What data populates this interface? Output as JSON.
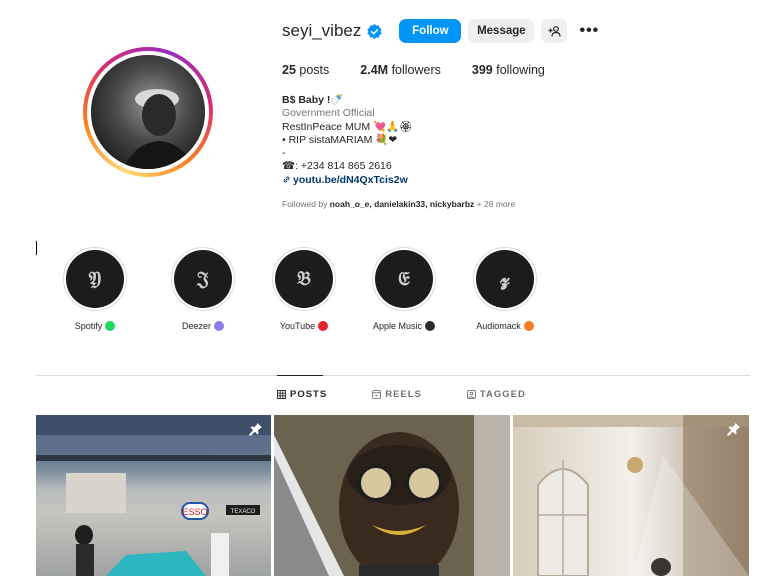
{
  "profile": {
    "username": "seyi_vibez",
    "follow_label": "Follow",
    "message_label": "Message",
    "more_label": "•••",
    "stats": {
      "posts_count": "25",
      "posts_label": "posts",
      "followers_count": "2.4M",
      "followers_label": "followers",
      "following_count": "399",
      "following_label": "following"
    },
    "bio": {
      "name": "B$ Baby !🍼",
      "category": "Government Official",
      "line1": "RestInPeace MUM 💘🙏🏵",
      "line2": "• RIP sistaMARIAM 💐❤",
      "line3": "-",
      "phone": "☎: +234 814 865 2616",
      "link": "youtu.be/dN4QxTcis2w"
    },
    "followed_by": {
      "prefix": "Followed by",
      "names": "noah_o_e, danielakin33, nickybarbz",
      "suffix": "+ 28 more"
    }
  },
  "highlights": [
    {
      "glyph": "𝔜",
      "label": "Spotify",
      "dot_color": "#1ed760"
    },
    {
      "glyph": "𝔍",
      "label": "Deezer",
      "dot_color": "#8c7be8"
    },
    {
      "glyph": "𝔅",
      "label": "YouTube",
      "dot_color": "#e8212e"
    },
    {
      "glyph": "𝔈",
      "label": "Apple Music",
      "dot_color": "#2b2b2b"
    },
    {
      "glyph": "𝔃",
      "label": "Audiomack",
      "dot_color": "#f57a20"
    }
  ],
  "tabs": [
    {
      "label": "POSTS",
      "icon": "grid-icon",
      "active": true
    },
    {
      "label": "REELS",
      "icon": "reels-icon",
      "active": false
    },
    {
      "label": "TAGGED",
      "icon": "tagged-icon",
      "active": false
    }
  ],
  "posts": [
    {
      "pinned": true
    },
    {
      "pinned": false
    },
    {
      "pinned": true
    }
  ],
  "colors": {
    "accent": "#0095f6",
    "verified": "#0095f6",
    "link": "#00376b",
    "muted": "#737373"
  }
}
